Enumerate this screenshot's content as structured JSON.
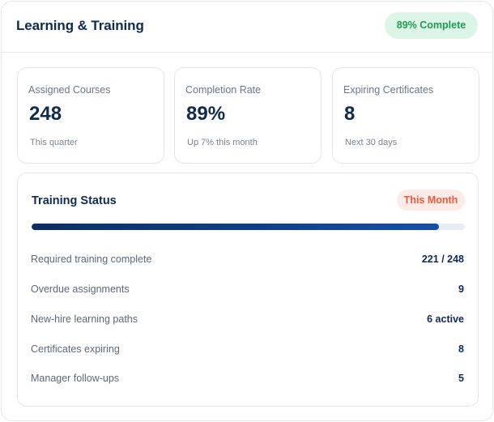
{
  "header": {
    "title": "Learning & Training",
    "badge": "89% Complete"
  },
  "stats": [
    {
      "label": "Assigned Courses",
      "value": "248",
      "sub": "This quarter"
    },
    {
      "label": "Completion Rate",
      "value": "89%",
      "sub": "Up 7% this month"
    },
    {
      "label": "Expiring Certificates",
      "value": "8",
      "sub": "Next 30 days"
    }
  ],
  "status": {
    "title": "Training Status",
    "badge": "This Month",
    "progress": 0.94,
    "rows": [
      {
        "label": "Required training complete",
        "value": "221 / 248"
      },
      {
        "label": "Overdue assignments",
        "value": "9"
      },
      {
        "label": "New-hire learning paths",
        "value": "6 active"
      },
      {
        "label": "Certificates expiring",
        "value": "8"
      },
      {
        "label": "Manager follow-ups",
        "value": "5"
      }
    ]
  },
  "colors": {
    "accent": "#0f2a4f",
    "success": "#1f9a55",
    "warning": "#ec5b3d",
    "progress": "#0f3f85"
  }
}
